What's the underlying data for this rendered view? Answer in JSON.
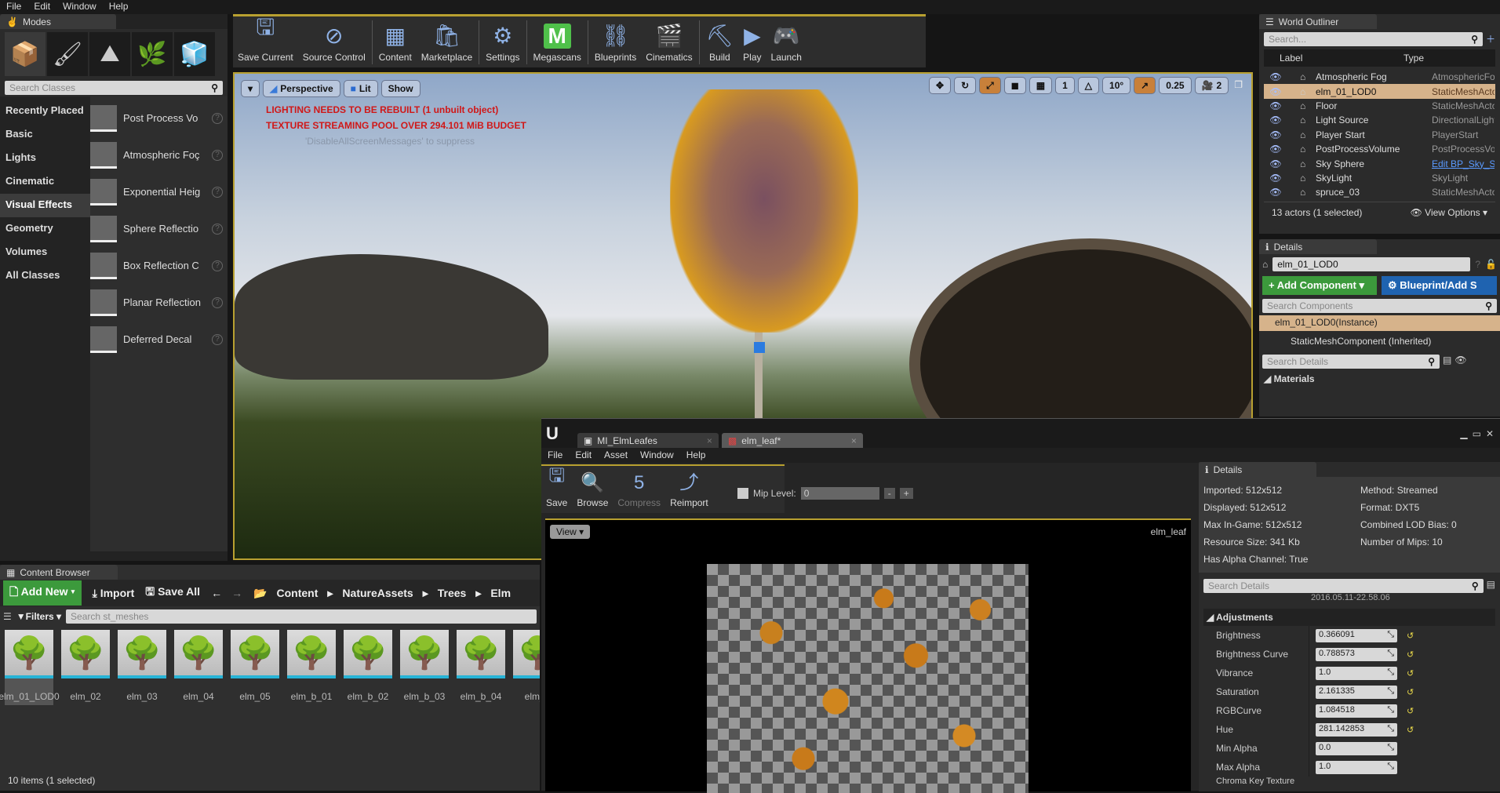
{
  "menu": [
    "File",
    "Edit",
    "Window",
    "Help"
  ],
  "modes": {
    "tab": "Modes",
    "search_placeholder": "Search Classes",
    "categories": [
      "Recently Placed",
      "Basic",
      "Lights",
      "Cinematic",
      "Visual Effects",
      "Geometry",
      "Volumes",
      "All Classes"
    ],
    "selected_category": "Visual Effects",
    "items": [
      "Post Process Vo",
      "Atmospheric Foç",
      "Exponential Heig",
      "Sphere Reflectio",
      "Box Reflection C",
      "Planar Reflection",
      "Deferred Decal"
    ]
  },
  "toolbar": [
    {
      "label": "Save Current",
      "icon": "floppy-icon"
    },
    {
      "label": "Source Control",
      "icon": "source-control-icon"
    },
    {
      "label": "Content",
      "icon": "content-icon"
    },
    {
      "label": "Marketplace",
      "icon": "marketplace-icon"
    },
    {
      "label": "Settings",
      "icon": "gear-icon"
    },
    {
      "label": "Megascans",
      "icon": "megascans-icon"
    },
    {
      "label": "Blueprints",
      "icon": "blueprint-icon"
    },
    {
      "label": "Cinematics",
      "icon": "clapper-icon"
    },
    {
      "label": "Build",
      "icon": "build-icon"
    },
    {
      "label": "Play",
      "icon": "play-icon"
    },
    {
      "label": "Launch",
      "icon": "launch-icon"
    }
  ],
  "viewport": {
    "perspective": "Perspective",
    "lit": "Lit",
    "show": "Show",
    "messages": [
      "LIGHTING NEEDS TO BE REBUILT (1 unbuilt object)",
      "TEXTURE STREAMING POOL OVER 294.101 MiB BUDGET"
    ],
    "suppress": "'DisableAllScreenMessages' to suppress",
    "grid_snap": "1",
    "rot_snap": "10°",
    "scale_snap": "0.25",
    "camera_speed": "2"
  },
  "outliner": {
    "tab": "World Outliner",
    "search_placeholder": "Search...",
    "col_label": "Label",
    "col_type": "Type",
    "rows": [
      {
        "label": "Atmospheric Fog",
        "type": "AtmosphericFog"
      },
      {
        "label": "elm_01_LOD0",
        "type": "StaticMeshActor",
        "selected": true
      },
      {
        "label": "Floor",
        "type": "StaticMeshActor"
      },
      {
        "label": "Light Source",
        "type": "DirectionalLight"
      },
      {
        "label": "Player Start",
        "type": "PlayerStart"
      },
      {
        "label": "PostProcessVolume",
        "type": "PostProcessVolume"
      },
      {
        "label": "Sky Sphere",
        "type": "Edit BP_Sky_Sphere"
      },
      {
        "label": "SkyLight",
        "type": "SkyLight"
      },
      {
        "label": "spruce_03",
        "type": "StaticMeshActor"
      }
    ],
    "status": "13 actors (1 selected)",
    "view_options": "View Options"
  },
  "details": {
    "tab": "Details",
    "name": "elm_01_LOD0",
    "add_component": "+ Add Component",
    "blueprint": "Blueprint/Add S",
    "search_components": "Search Components",
    "instance": "elm_01_LOD0(Instance)",
    "component": "StaticMeshComponent (Inherited)",
    "search_details": "Search Details",
    "materials": "Materials"
  },
  "content_browser": {
    "tab": "Content Browser",
    "add_new": "Add New",
    "import": "Import",
    "save_all": "Save All",
    "path": [
      "Content",
      "NatureAssets",
      "Trees",
      "Elm"
    ],
    "filters": "Filters",
    "search_placeholder": "Search st_meshes",
    "assets": [
      "elm_01_LOD0",
      "elm_02",
      "elm_03",
      "elm_04",
      "elm_05",
      "elm_b_01",
      "elm_b_02",
      "elm_b_03",
      "elm_b_04",
      "elm_b"
    ],
    "status": "10 items (1 selected)"
  },
  "texture_editor": {
    "tabs": [
      "MI_ElmLeafes",
      "elm_leaf*"
    ],
    "menu": [
      "File",
      "Edit",
      "Asset",
      "Window",
      "Help"
    ],
    "tools": [
      "Save",
      "Browse",
      "Compress",
      "Reimport"
    ],
    "mip_label": "Mip Level:",
    "mip_value": "0",
    "view": "View",
    "texture_name": "elm_leaf",
    "details_tab": "Details",
    "info_left": [
      "Imported: 512x512",
      "Displayed: 512x512",
      "Max In-Game: 512x512",
      "Resource Size: 341 Kb",
      "Has Alpha Channel: True"
    ],
    "info_right": [
      "Method: Streamed",
      "Format: DXT5",
      "Combined LOD Bias: 0",
      "Number of Mips: 10"
    ],
    "search_details": "Search Details",
    "timestamp": "2016.05.11-22.58.06",
    "section": "Adjustments",
    "props": [
      {
        "name": "Brightness",
        "value": "0.366091",
        "reset": true
      },
      {
        "name": "Brightness Curve",
        "value": "0.788573",
        "reset": true
      },
      {
        "name": "Vibrance",
        "value": "1.0",
        "reset": true
      },
      {
        "name": "Saturation",
        "value": "2.161335",
        "reset": true
      },
      {
        "name": "RGBCurve",
        "value": "1.084518",
        "reset": true
      },
      {
        "name": "Hue",
        "value": "281.142853",
        "reset": true
      },
      {
        "name": "Min Alpha",
        "value": "0.0",
        "reset": false
      },
      {
        "name": "Max Alpha",
        "value": "1.0",
        "reset": false
      }
    ],
    "chroma": "Chroma Key Texture"
  },
  "colors": {
    "accent_orange": "#c8803a",
    "selected_row": "#d6b38b",
    "green_button": "#3c9a3c",
    "blue_button": "#1f63b0",
    "warning": "#d01818"
  }
}
